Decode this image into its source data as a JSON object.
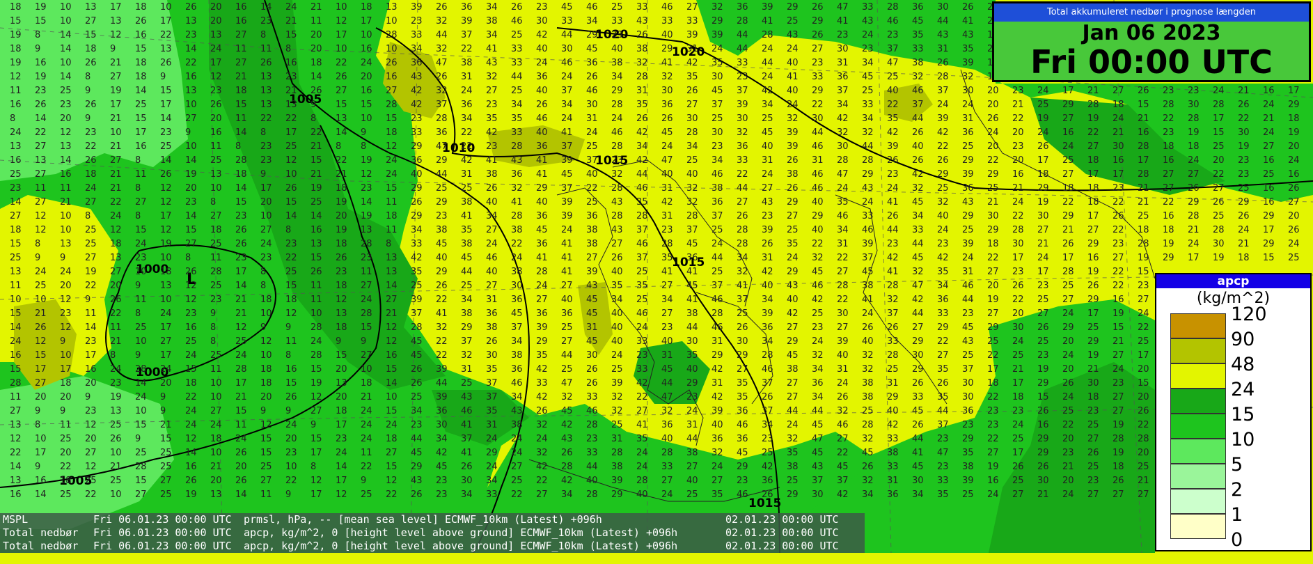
{
  "title": {
    "strip": "Total akkumuleret nedbør i prognose længden",
    "date": "Jan 06 2023",
    "time": "Fri 00:00 UTC"
  },
  "legend": {
    "header": "apcp",
    "units": "(kg/m^2)",
    "entries": [
      {
        "label": "120",
        "color": "#c89200"
      },
      {
        "label": "90",
        "color": "#b3c400"
      },
      {
        "label": "48",
        "color": "#e3f500"
      },
      {
        "label": "24",
        "color": "#18a818"
      },
      {
        "label": "15",
        "color": "#1ec41e"
      },
      {
        "label": "10",
        "color": "#5de85d"
      },
      {
        "label": "5",
        "color": "#9af59a"
      },
      {
        "label": "2",
        "color": "#ccffcc"
      },
      {
        "label": "1",
        "color": "#ffffc8"
      },
      {
        "label": "0",
        "color": ""
      }
    ]
  },
  "status_lines": [
    {
      "field": "MSPL",
      "valid": "Fri 06.01.23 00:00 UTC",
      "desc": "prmsl, hPa, -- [mean sea level] ECMWF_10km (Latest) +096h",
      "run": "02.01.23 00:00 UTC"
    },
    {
      "field": "Total nedbør",
      "valid": "Fri 06.01.23 00:00 UTC",
      "desc": "apcp, kg/m^2, 0 [height level above ground] ECMWF_10km (Latest) +096h",
      "run": "02.01.23 00:00 UTC"
    },
    {
      "field": "Total nedbør",
      "valid": "Fri 06.01.23 00:00 UTC",
      "desc": "apcp, kg/m^2, 0 [height level above ground] ECMWF_10km (Latest) +096h",
      "run": "02.01.23 00:00 UTC"
    }
  ],
  "isobar_labels": [
    "1020",
    "1020",
    "1005",
    "1010",
    "1015",
    "1015",
    "1000",
    "1000",
    "1005",
    "1015"
  ],
  "low_marker": "L",
  "colors": {
    "zone_green_dark": "#18a818",
    "zone_green_mid": "#1ec41e",
    "zone_green_light": "#5de85d",
    "zone_yellow": "#e3f500",
    "zone_olive": "#b3c400"
  }
}
